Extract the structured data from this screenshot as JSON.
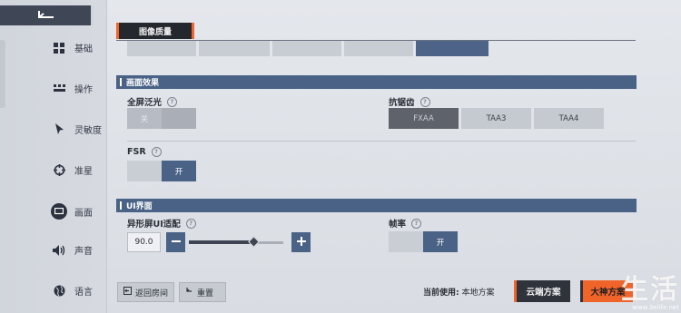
{
  "sidebar": {
    "items": [
      {
        "label": "基础",
        "icon": "grid-icon"
      },
      {
        "label": "操作",
        "icon": "keyboard-icon"
      },
      {
        "label": "灵敏度",
        "icon": "cursor-icon"
      },
      {
        "label": "准星",
        "icon": "crosshair-icon"
      },
      {
        "label": "画面",
        "icon": "monitor-icon",
        "active": true
      },
      {
        "label": "声音",
        "icon": "speaker-icon"
      },
      {
        "label": "语言",
        "icon": "globe-icon"
      }
    ]
  },
  "header": {
    "tab_title": "图像质量"
  },
  "sections": {
    "effects": "画面效果",
    "ui": "UI界面"
  },
  "bloom": {
    "label": "全屏泛光",
    "options": [
      "关",
      ""
    ],
    "selected": 0
  },
  "antialias": {
    "label": "抗锯齿",
    "options": [
      "FXAA",
      "TAA3",
      "TAA4"
    ],
    "selected": 0
  },
  "fsr": {
    "label": "FSR",
    "options": [
      "",
      "开"
    ],
    "selected": 1
  },
  "ui_adapt": {
    "label": "异形屏UI适配",
    "value": "90.0",
    "slider_fraction": 0.68
  },
  "framerate": {
    "label": "帧率",
    "options": [
      "",
      "开"
    ],
    "selected": 1
  },
  "footer": {
    "back_room": "返回房间",
    "reset": "重置",
    "current_prefix": "当前使用:",
    "current_value": "本地方案",
    "cloud": "云端方案",
    "master": "大神方案"
  },
  "watermark": {
    "big": "生活",
    "small": "www.3elife.net"
  },
  "colors": {
    "accent": "#f0642a",
    "primary": "#4a6286",
    "dark": "#2f333c"
  }
}
